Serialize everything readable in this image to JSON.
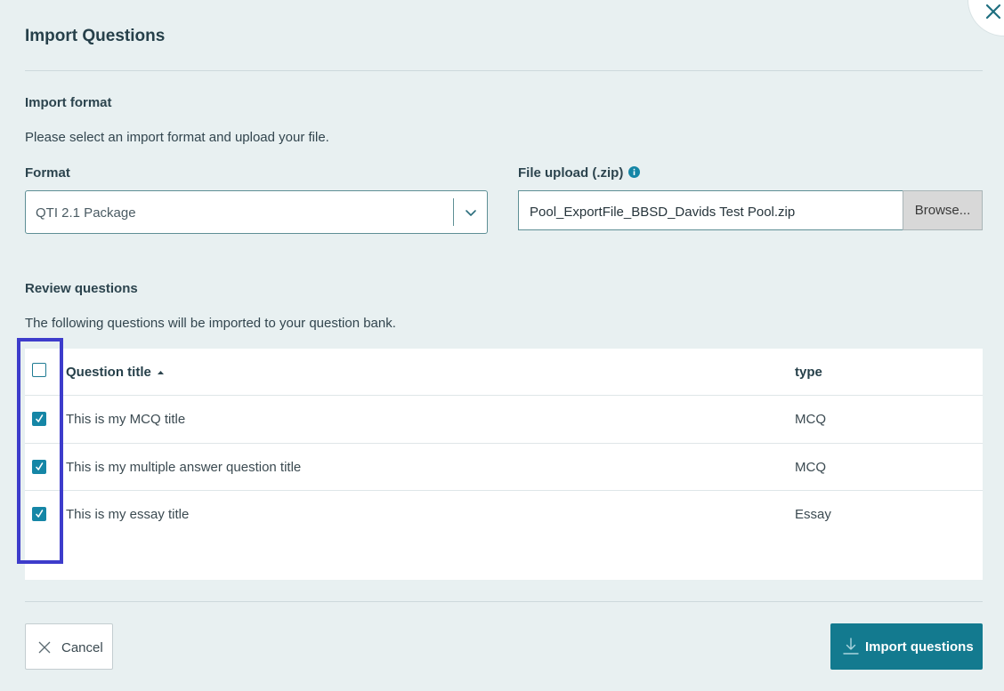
{
  "dialog": {
    "title": "Import Questions"
  },
  "import_format": {
    "heading": "Import format",
    "description": "Please select an import format and upload your file.",
    "format_label": "Format",
    "format_value": "QTI 2.1 Package",
    "file_label": "File upload (.zip)",
    "file_value": "Pool_ExportFile_BBSD_Davids Test Pool.zip",
    "browse_label": "Browse..."
  },
  "review": {
    "heading": "Review questions",
    "description": "The following questions will be imported to your question bank.",
    "columns": {
      "title": "Question title",
      "type": "type"
    },
    "rows": [
      {
        "title": "This is my MCQ title",
        "type": "MCQ",
        "checked": true
      },
      {
        "title": "This is my multiple answer question title",
        "type": "MCQ",
        "checked": true
      },
      {
        "title": "This is my essay title",
        "type": "Essay",
        "checked": true
      }
    ],
    "select_all_checked": false
  },
  "footer": {
    "cancel_label": "Cancel",
    "import_label": "Import questions"
  },
  "colors": {
    "background": "#e8f0f1",
    "accent": "#137a8f",
    "checkbox": "#1586a6",
    "highlight": "#3d3ccb",
    "info_icon": "#1586a6"
  },
  "icons": {
    "close": "close-icon",
    "chevron": "chevron-down-icon",
    "info": "info-icon",
    "sort": "sort-up-icon",
    "cancel": "close-icon",
    "import": "download-icon",
    "check": "checkmark-icon"
  }
}
